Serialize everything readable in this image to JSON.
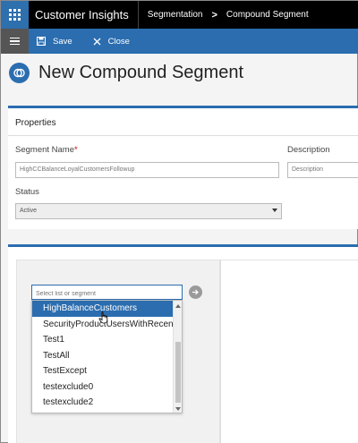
{
  "app": {
    "title": "Customer Insights",
    "breadcrumb": [
      "Segmentation",
      "Compound Segment"
    ],
    "breadcrumb_separator": ">"
  },
  "commandbar": {
    "save_label": "Save",
    "close_label": "Close"
  },
  "page": {
    "title": "New Compound Segment"
  },
  "properties": {
    "section_title": "Properties",
    "segment_name_label": "Segment Name",
    "required_marker": "*",
    "segment_name_value": "HighCCBalanceLoyalCustomersFollowup",
    "description_label": "Description",
    "description_placeholder": "Description",
    "status_label": "Status",
    "status_value": "Active"
  },
  "builder": {
    "segment_input_placeholder": "Select list or segment",
    "dropdown_items": [
      "HighBalanceCustomers",
      "SecurityProductUsersWithRecent",
      "Test1",
      "TestAll",
      "TestExcept",
      "testexclude0",
      "testexclude2"
    ],
    "selected_index": 0
  },
  "colors": {
    "accent": "#2b6daf",
    "topbar": "#000000",
    "required": "#cc0000"
  }
}
